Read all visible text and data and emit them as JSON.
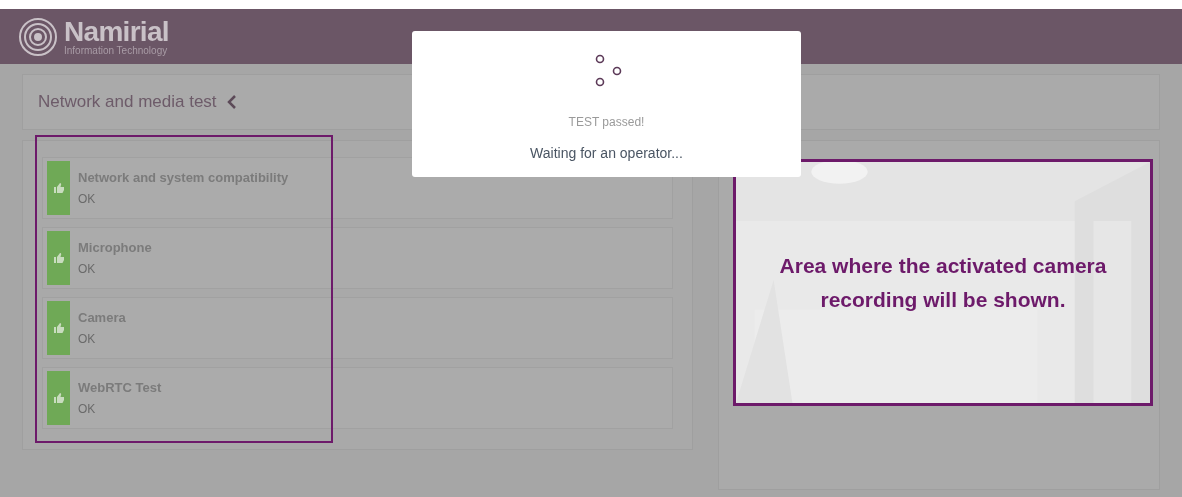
{
  "header": {
    "logo_name": "Namirial",
    "logo_tagline": "Information Technology"
  },
  "panel": {
    "title": "Network and media test"
  },
  "tests": [
    {
      "name": "Network and system compatibility",
      "status": "OK",
      "passed": true
    },
    {
      "name": "Microphone",
      "status": "OK",
      "passed": true
    },
    {
      "name": "Camera",
      "status": "OK",
      "passed": true
    },
    {
      "name": "WebRTC Test",
      "status": "OK",
      "passed": true
    }
  ],
  "modal": {
    "status": "TEST passed!",
    "message": "Waiting for an operator..."
  },
  "camera": {
    "caption": "Area where the activated camera recording will be shown."
  }
}
